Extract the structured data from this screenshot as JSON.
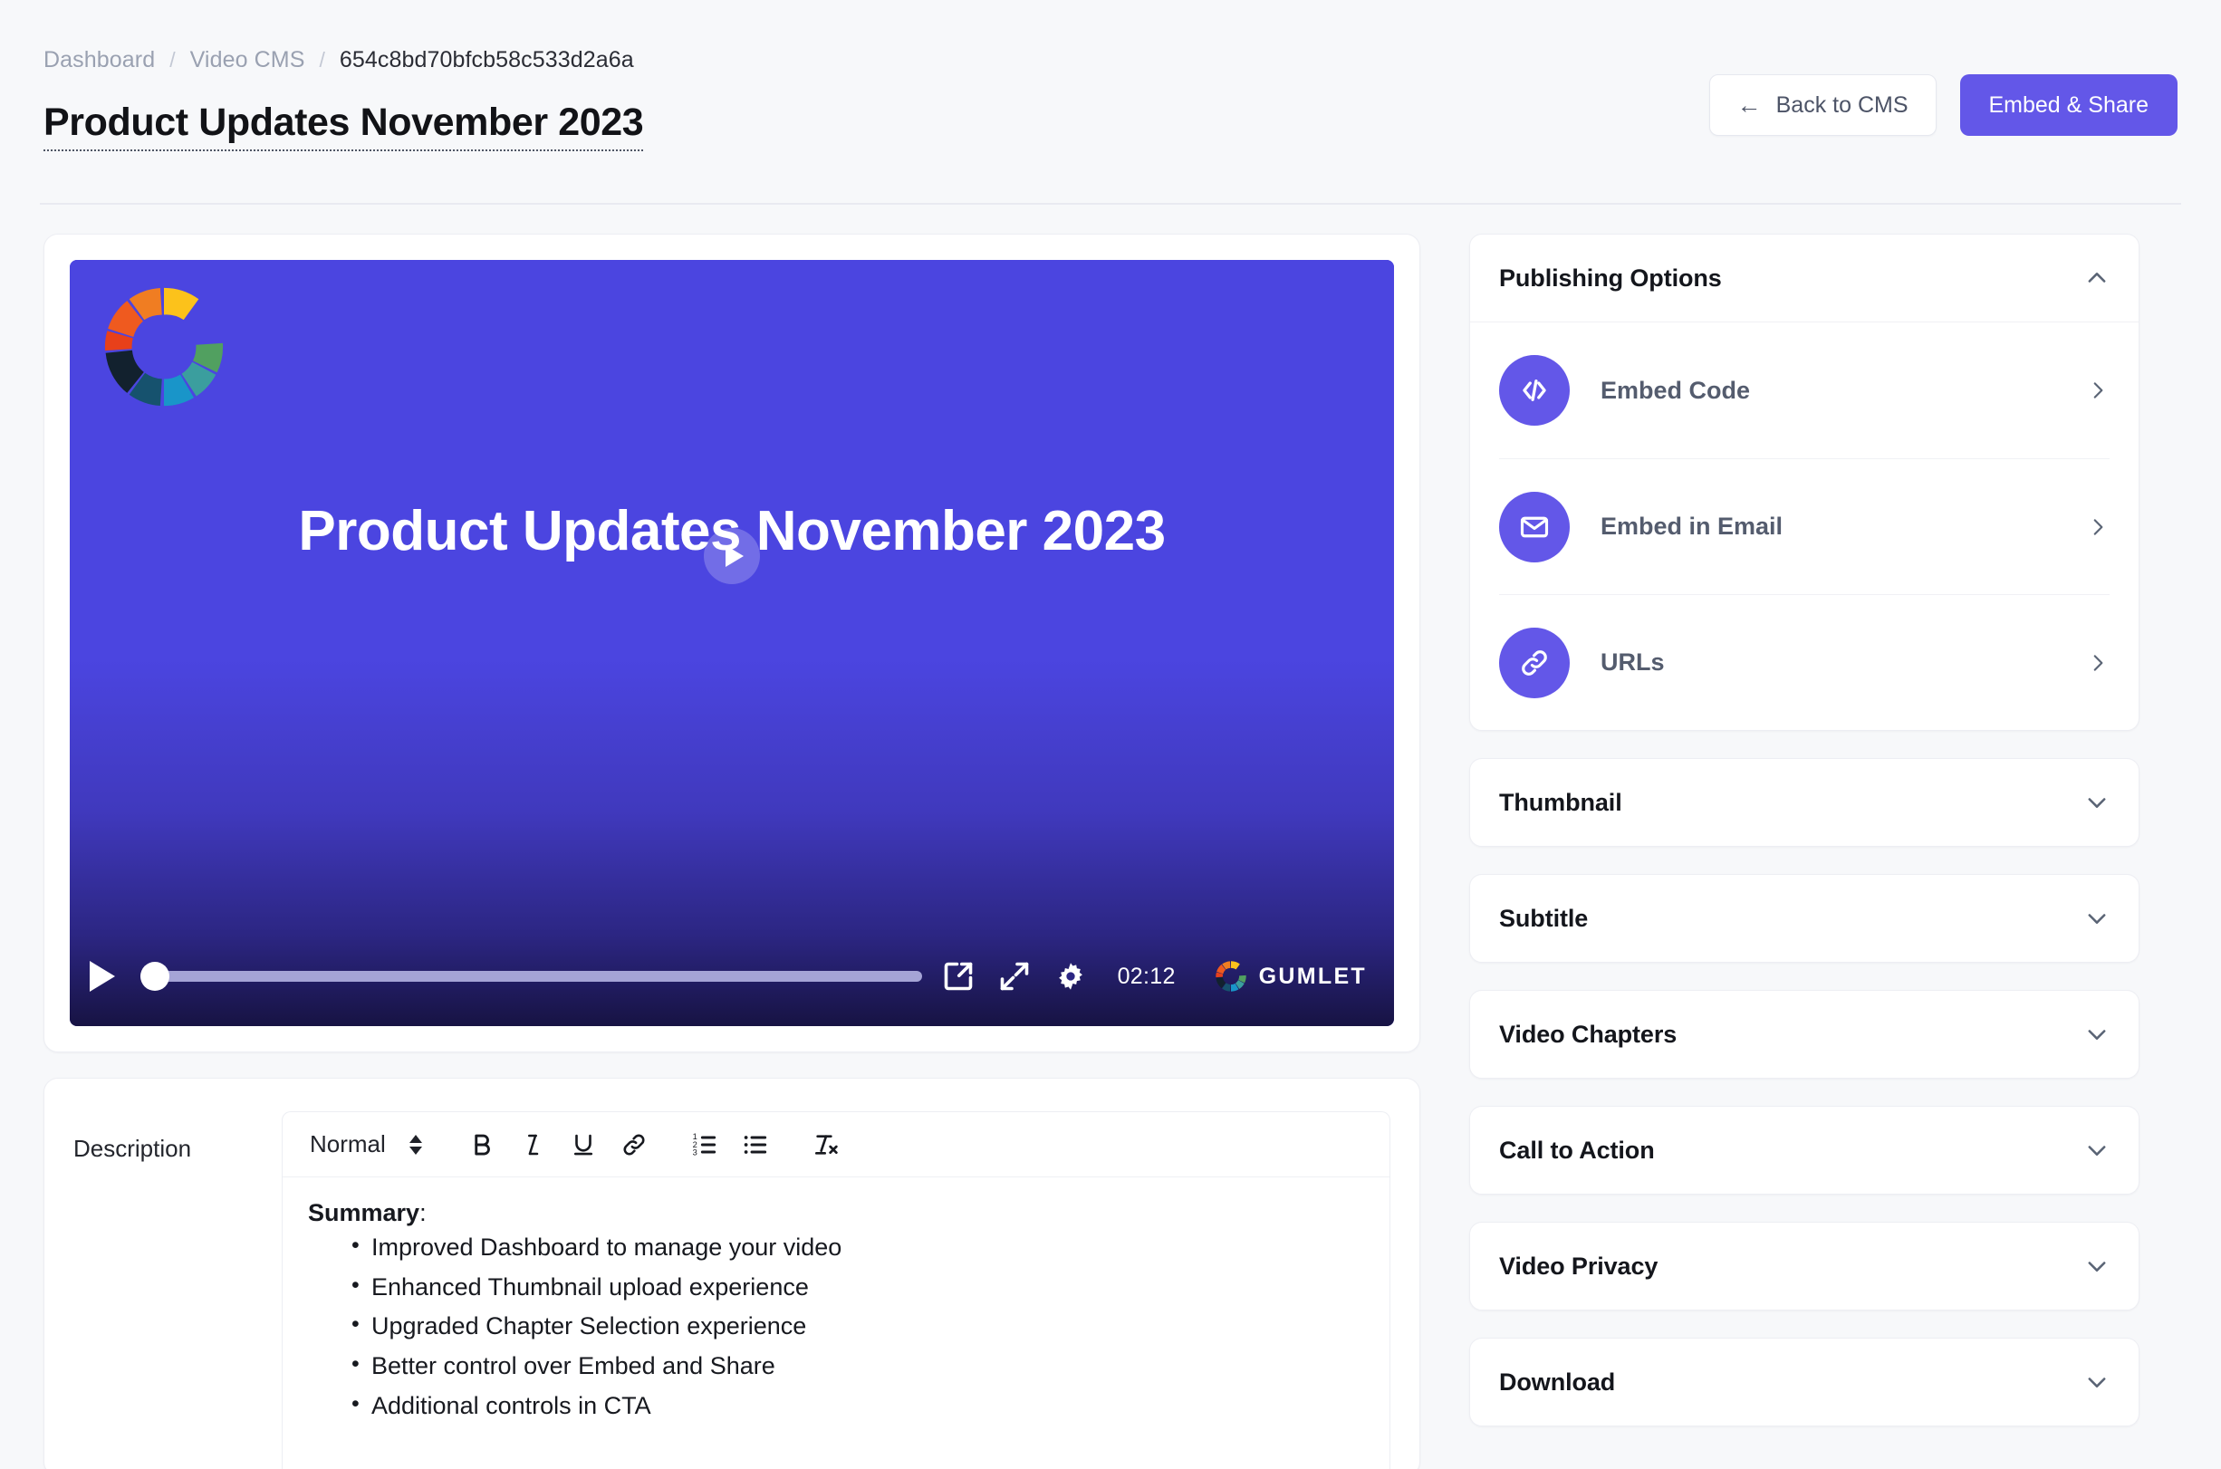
{
  "breadcrumb": {
    "items": [
      {
        "label": "Dashboard",
        "current": false
      },
      {
        "label": "Video CMS",
        "current": false
      },
      {
        "label": "654c8bd70bfcb58c533d2a6a",
        "current": true
      }
    ],
    "separator": "/"
  },
  "page": {
    "title": "Product Updates November 2023"
  },
  "header": {
    "back_label": "Back to CMS",
    "back_icon": "arrow-left-icon",
    "back_arrow": "←",
    "primary_label": "Embed & Share",
    "primary_color": "#6357e8"
  },
  "player": {
    "overlay_title": "Product Updates November 2023",
    "time": "02:12",
    "brand": "GUMLET",
    "background_color": "#4b45e0",
    "progress_percent": 0,
    "icons": {
      "play": "play-icon",
      "popout": "external-link-icon",
      "fullscreen": "fullscreen-expand-icon",
      "settings": "gear-icon",
      "logo": "gumlet-color-wheel-icon"
    }
  },
  "description": {
    "label": "Description",
    "toolbar": {
      "block_format": "Normal",
      "buttons": [
        {
          "name": "bold-button",
          "glyph": "B"
        },
        {
          "name": "italic-button",
          "glyph": "I"
        },
        {
          "name": "underline-button",
          "glyph": "U"
        },
        {
          "name": "link-button",
          "glyph": "link-icon"
        },
        {
          "name": "ordered-list-button",
          "glyph": "ordered-list-icon"
        },
        {
          "name": "bullet-list-button",
          "glyph": "bullet-list-icon"
        },
        {
          "name": "clear-format-button",
          "glyph": "clear-formatting-icon"
        }
      ]
    },
    "content": {
      "heading": "Summary",
      "heading_suffix": ":",
      "bullets": [
        "Improved Dashboard to manage your video",
        "Enhanced Thumbnail upload experience",
        "Upgraded Chapter Selection experience",
        "Better control over Embed and Share",
        "Additional controls in CTA"
      ]
    }
  },
  "sidebar": {
    "publishing": {
      "title": "Publishing Options",
      "expanded": true,
      "chevron": "chevron-up-icon",
      "options": [
        {
          "label": "Embed Code",
          "icon": "code-icon"
        },
        {
          "label": "Embed in Email",
          "icon": "envelope-icon"
        },
        {
          "label": "URLs",
          "icon": "link-icon"
        }
      ]
    },
    "sections": [
      {
        "title": "Thumbnail",
        "chevron": "chevron-down-icon"
      },
      {
        "title": "Subtitle",
        "chevron": "chevron-down-icon"
      },
      {
        "title": "Video Chapters",
        "chevron": "chevron-down-icon"
      },
      {
        "title": "Call to Action",
        "chevron": "chevron-down-icon"
      },
      {
        "title": "Video Privacy",
        "chevron": "chevron-down-icon"
      },
      {
        "title": "Download",
        "chevron": "chevron-down-icon"
      }
    ]
  }
}
